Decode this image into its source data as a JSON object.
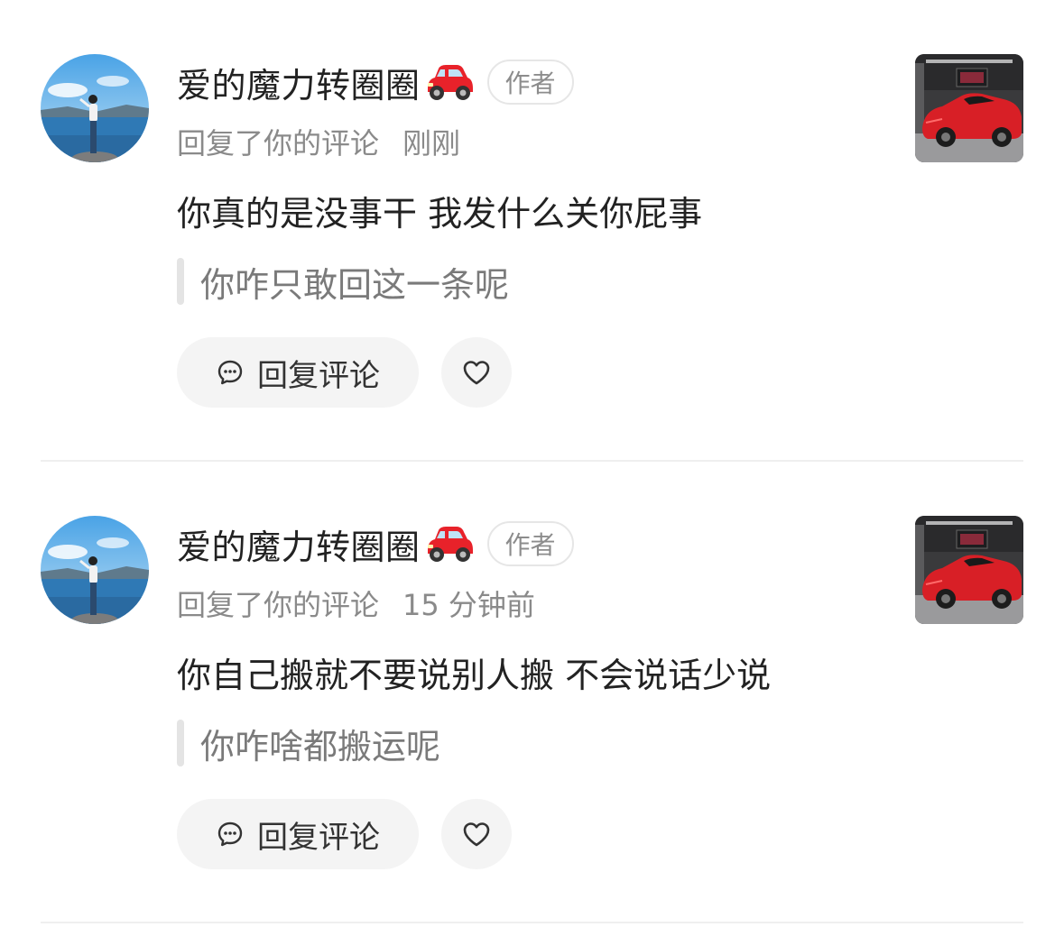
{
  "notifications": [
    {
      "username": "爱的魔力转圈圈",
      "badge": "作者",
      "action": "回复了你的评论",
      "time": "刚刚",
      "reply": "你真的是没事干 我发什么关你屁事",
      "quote": "你咋只敢回这一条呢",
      "reply_button": "回复评论"
    },
    {
      "username": "爱的魔力转圈圈",
      "badge": "作者",
      "action": "回复了你的评论",
      "time": "15 分钟前",
      "reply": "你自己搬就不要说别人搬 不会说话少说",
      "quote": "你咋啥都搬运呢",
      "reply_button": "回复评论"
    }
  ],
  "icons": {
    "username_emoji": "red-car-emoji",
    "reply": "comment-bubble-icon",
    "like": "heart-outline-icon"
  },
  "colors": {
    "background": "#ffffff",
    "primary_text": "#222222",
    "secondary_text": "#8a8a8a",
    "button_bg": "#f4f4f4",
    "car_red": "#e8222a"
  }
}
